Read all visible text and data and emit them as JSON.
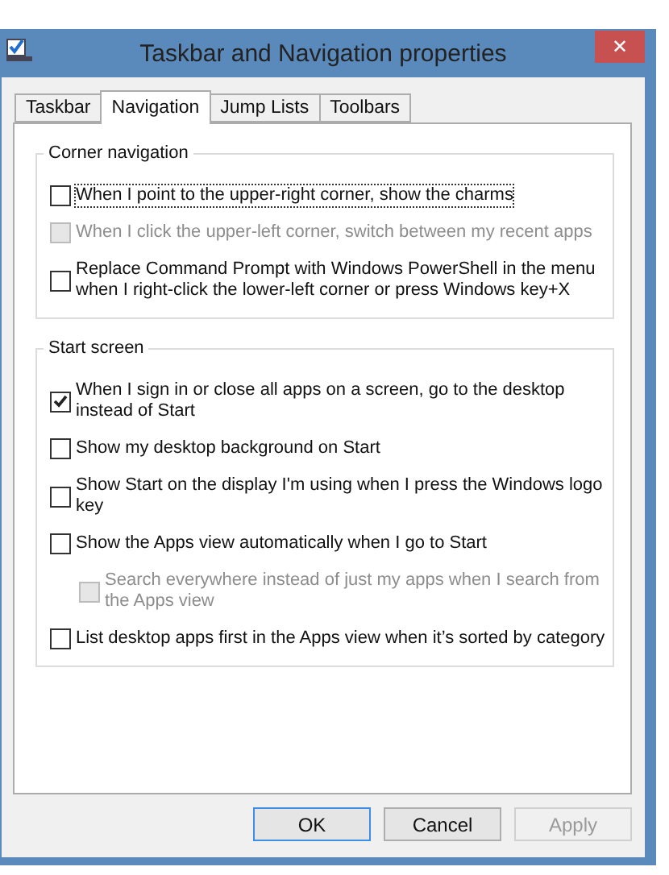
{
  "window": {
    "title": "Taskbar and Navigation properties",
    "close": "✕"
  },
  "tabs": [
    {
      "label": "Taskbar",
      "selected": false
    },
    {
      "label": "Navigation",
      "selected": true
    },
    {
      "label": "Jump Lists",
      "selected": false
    },
    {
      "label": "Toolbars",
      "selected": false
    }
  ],
  "groups": [
    {
      "title": "Corner navigation",
      "options": [
        {
          "label": "When I point to the upper-right corner, show the charms",
          "checked": false,
          "disabled": false,
          "focused": true
        },
        {
          "label": "When I click the upper-left corner, switch between my recent apps",
          "checked": false,
          "disabled": true,
          "focused": false
        },
        {
          "label": "Replace Command Prompt with Windows PowerShell in the menu when I right-click the lower-left corner or press Windows key+X",
          "checked": false,
          "disabled": false,
          "focused": false
        }
      ]
    },
    {
      "title": "Start screen",
      "options": [
        {
          "label": "When I sign in or close all apps on a screen, go to the desktop instead of Start",
          "checked": true,
          "disabled": false,
          "focused": false
        },
        {
          "label": "Show my desktop background on Start",
          "checked": false,
          "disabled": false,
          "focused": false
        },
        {
          "label": "Show Start on the display I'm using when I press the Windows logo key",
          "checked": false,
          "disabled": false,
          "focused": false
        },
        {
          "label": "Show the Apps view automatically when I go to Start",
          "checked": false,
          "disabled": false,
          "focused": false,
          "children": [
            {
              "label": "Search everywhere instead of just my apps when I search from the Apps view",
              "checked": false,
              "disabled": true,
              "focused": false
            }
          ]
        },
        {
          "label": "List desktop apps first in the Apps view when it’s sorted by category",
          "checked": false,
          "disabled": false,
          "focused": false
        }
      ]
    }
  ],
  "buttons": [
    {
      "label": "OK",
      "default": true,
      "disabled": false
    },
    {
      "label": "Cancel",
      "default": false,
      "disabled": false
    },
    {
      "label": "Apply",
      "default": false,
      "disabled": true
    }
  ]
}
